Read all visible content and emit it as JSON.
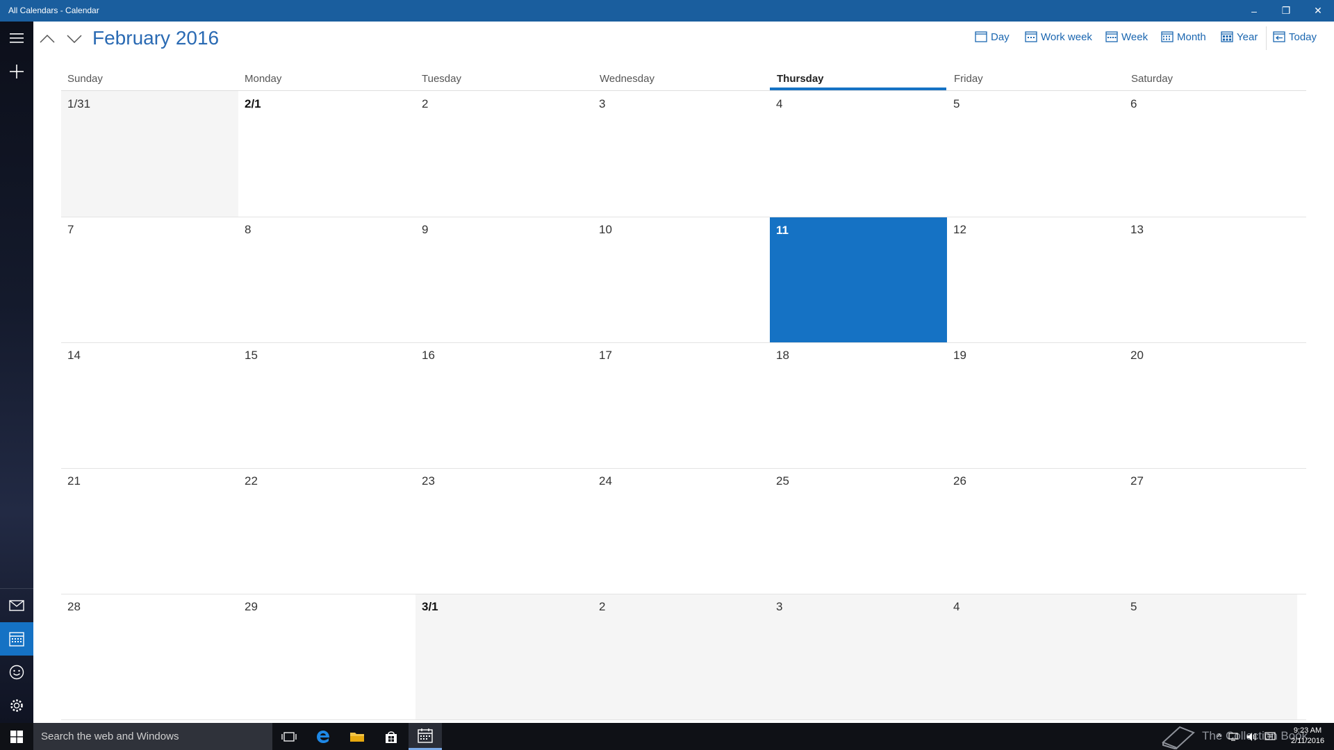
{
  "window": {
    "title": "All Calendars - Calendar",
    "minimize_label": "–",
    "restore_label": "❐",
    "close_label": "✕"
  },
  "header": {
    "month_title": "February 2016",
    "views": [
      {
        "label": "Day",
        "icon": "day-view-icon"
      },
      {
        "label": "Work week",
        "icon": "work-week-view-icon"
      },
      {
        "label": "Week",
        "icon": "week-view-icon"
      },
      {
        "label": "Month",
        "icon": "month-view-icon"
      },
      {
        "label": "Year",
        "icon": "year-view-icon"
      },
      {
        "label": "Today",
        "icon": "today-icon"
      }
    ]
  },
  "calendar": {
    "day_names": [
      "Sunday",
      "Monday",
      "Tuesday",
      "Wednesday",
      "Thursday",
      "Friday",
      "Saturday"
    ],
    "today_column": "Thursday",
    "weeks": [
      [
        "1/31",
        "2/1",
        "2",
        "3",
        "4",
        "5",
        "6"
      ],
      [
        "7",
        "8",
        "9",
        "10",
        "11",
        "12",
        "13"
      ],
      [
        "14",
        "15",
        "16",
        "17",
        "18",
        "19",
        "20"
      ],
      [
        "21",
        "22",
        "23",
        "24",
        "25",
        "26",
        "27"
      ],
      [
        "28",
        "29",
        "3/1",
        "2",
        "3",
        "4",
        "5"
      ]
    ],
    "today_date": "11"
  },
  "taskbar": {
    "search_placeholder": "Search the web and Windows",
    "watermark": "The Collection Book",
    "time": "9:23 AM",
    "date": "2/11/2016"
  },
  "colors": {
    "accent": "#1572c4",
    "titlebar": "#1a5e9e",
    "out_of_month": "#f5f5f5"
  }
}
